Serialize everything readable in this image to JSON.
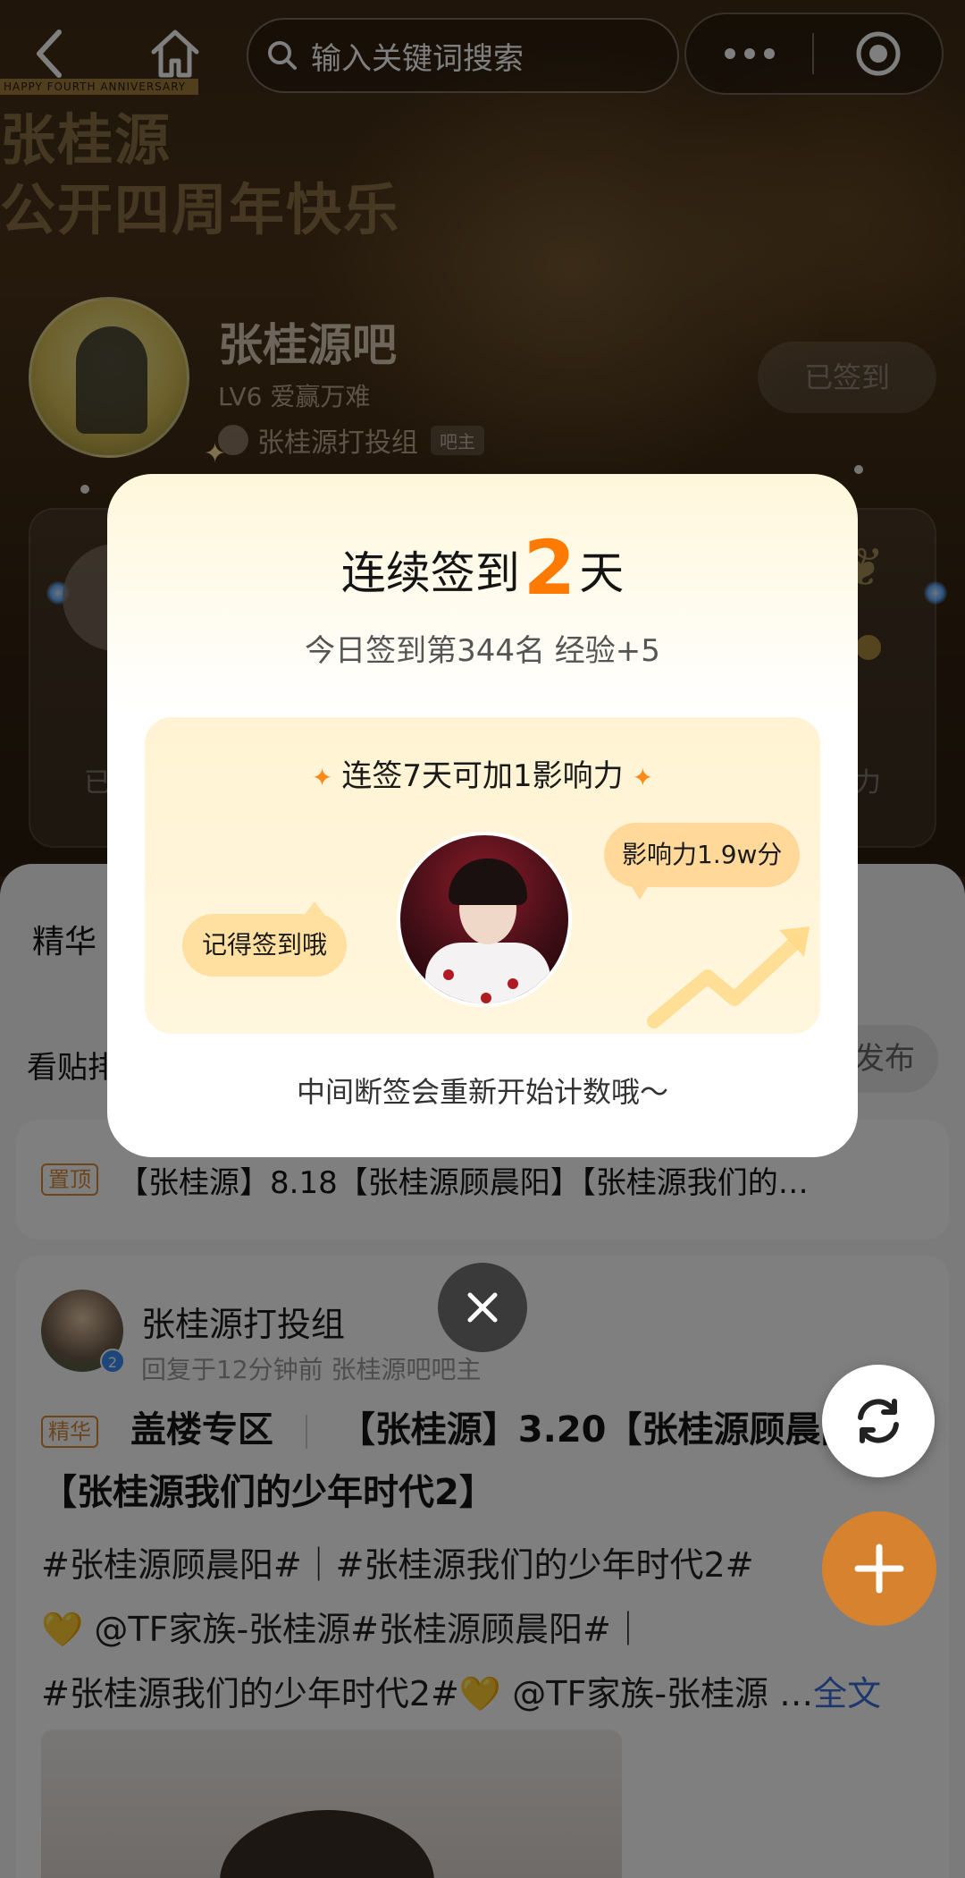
{
  "nav": {
    "back_icon": "back-chevron-icon",
    "home_icon": "home-icon",
    "search_placeholder": "输入关键词搜索",
    "more_icon": "more-dots-icon",
    "target_icon": "target-icon"
  },
  "banner": {
    "anniversary_text": "HAPPY FOURTH ANNIVERSARY",
    "title_line1": "张桂源",
    "title_line2": "公开四周年快乐"
  },
  "forum": {
    "name": "张桂源吧",
    "level": "LV6 爱赢万难",
    "owner_name": "张桂源打投组",
    "owner_badge": "吧主",
    "signed_button": "已签到",
    "card_left_label": "已",
    "card_right_label": "力"
  },
  "modal": {
    "title_prefix": "连续签到",
    "streak_days": "2",
    "title_suffix": "天",
    "subtitle": "今日签到第344名 经验+5",
    "bonus_title": "连签7天可加1影响力",
    "bubble_left": "记得签到哦",
    "bubble_right": "影响力1.9w分",
    "note": "中间断签会重新开始计数哦～"
  },
  "content": {
    "tab_featured": "精华",
    "sort_label": "看贴排",
    "publish_button": "发布",
    "pinned": {
      "tag": "置顶",
      "title": "【张桂源】8.18【张桂源顾晨阳】【张桂源我们的…"
    },
    "post": {
      "author": "张桂源打投组",
      "meta": "回复于12分钟前 张桂源吧吧主",
      "tag": "精华",
      "section": "盖楼专区",
      "title_rest": "【张桂源】3.20【张桂源顾晨阳】【张桂源我们的少年时代2】",
      "body_line1": "#张桂源顾晨阳#｜#张桂源我们的少年时代2#",
      "body_line2": "💛 @TF家族-张桂源#张桂源顾晨阳#｜",
      "body_line3": "#张桂源我们的少年时代2#💛 @TF家族-张桂源 …",
      "more_link": "全文"
    }
  },
  "colors": {
    "accent_orange": "#ff7a00",
    "fab_orange": "#d7822f",
    "link_blue": "#3b6fd9"
  }
}
